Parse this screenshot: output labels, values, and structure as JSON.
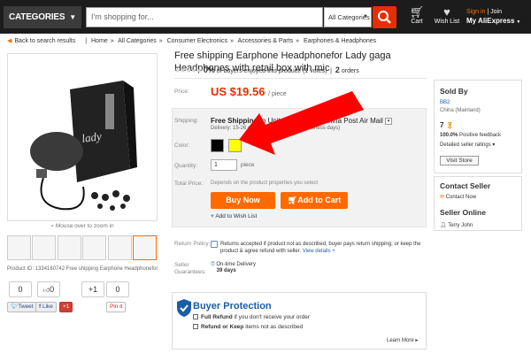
{
  "header": {
    "categories_label": "CATEGORIES",
    "search_placeholder": "I'm shopping for...",
    "category_select": "All Categories",
    "cart_label": "Cart",
    "wishlist_label": "Wish List",
    "sign_in": "Sign in",
    "join": "| Join",
    "my_account": "My AliExpress"
  },
  "breadcrumb": {
    "back": "Back to search results",
    "items": [
      "Home",
      "All Categories",
      "Consumer Electronics",
      "Accessories & Parts",
      "Earphones & Headphones"
    ]
  },
  "gallery": {
    "zoom_hint": "Mouse over to zoom in",
    "product_id": "Product ID: 1334160742 Free shipping Earphone Headphonefor"
  },
  "social": {
    "count_top_1": "0",
    "count_top_2": "0",
    "count_top_3": "+1",
    "count_top_4": "0",
    "tweet": "Tweet",
    "like": "Like",
    "plusone": "+1",
    "pinit": "Pin it"
  },
  "product": {
    "title": "Free shipping Earphone Headphonefor Lady gaga Headphones with retail box with mic",
    "rating_pct": "0%",
    "rating_text": "of buyers enjoyed this product! (1 votes)",
    "orders_count": "2",
    "orders_label": "orders",
    "price_label": "Price:",
    "price": "US $19.56",
    "price_unit": "/ piece",
    "shipping_label": "Shipping:",
    "shipping_free": "Free Shipping",
    "shipping_to": "to United States via China Post Air Mail",
    "delivery": "Delivery: 15-26 days (ships out within 3 business days)",
    "color_label": "Color:",
    "colors": [
      "#000000",
      "#ffff00"
    ],
    "quantity_label": "Quantity:",
    "quantity": "1",
    "quantity_unit": "piece",
    "total_label": "Total Price:",
    "total_text": "Depends on the product properties you select",
    "buy_now": "Buy Now",
    "add_to_cart": "Add to Cart",
    "wishlist": "Add to Wish List",
    "return_label": "Return Policy:",
    "return_text": "Returns accepted if product not as described, buyer pays return shipping; or keep the product & agree refund with seller.",
    "view_details": "View details +",
    "guarantee_label": "Seller Guarantees:",
    "ontime_label": "On-time Delivery",
    "ontime_days": "39 days"
  },
  "buyer_protection": {
    "title": "Buyer Protection",
    "line1_bold": "Full Refund",
    "line1": "if you don't receive your order",
    "line2_bold": "Refund or Keep",
    "line2": "items not as described",
    "learn_more": "Learn More"
  },
  "seller": {
    "sold_by": "Sold By",
    "store_id": "BB2",
    "country": "China (Mainland)",
    "score": "7",
    "feedback_pct": "100.0%",
    "feedback_label": "Positive feedback",
    "ratings_link": "Detailed seller ratings",
    "visit_store": "Visit Store",
    "contact_title": "Contact Seller",
    "contact_now": "Contact Now",
    "online_title": "Seller Online",
    "online_name": "Terry John"
  },
  "colors": {
    "accent": "#ff6a00",
    "price": "#e62e04",
    "arrow": "#ff0000",
    "protection": "#1a5da8"
  }
}
